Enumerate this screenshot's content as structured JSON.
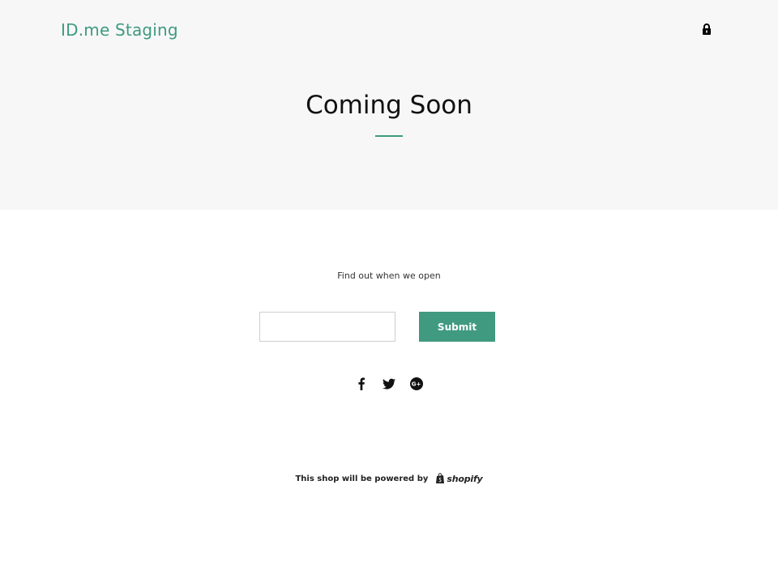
{
  "header": {
    "brand": "ID.me Staging",
    "lock_icon": "lock-icon"
  },
  "hero": {
    "title": "Coming Soon"
  },
  "signup": {
    "tagline": "Find out when we open",
    "email_value": "",
    "submit_label": "Submit"
  },
  "social": {
    "icons": [
      "facebook-icon",
      "twitter-icon",
      "google-plus-icon"
    ]
  },
  "footer": {
    "text": "This shop will be powered by",
    "logo_text": "shopify"
  },
  "colors": {
    "accent": "#3f9a80",
    "hero_bg": "#f7f7f7",
    "text": "#111111"
  }
}
